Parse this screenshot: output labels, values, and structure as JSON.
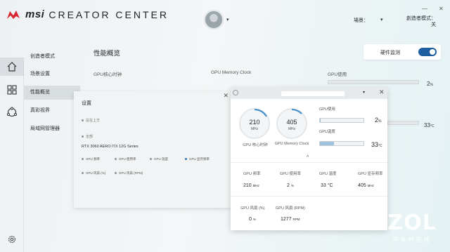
{
  "header": {
    "brand": "msi",
    "title": "CREATOR CENTER",
    "scene_label": "場景：",
    "creator_mode_line1": "創造者模式：",
    "creator_mode_line2": "关",
    "avatar_caret": "▾",
    "window_controls": [
      "—",
      "✕"
    ]
  },
  "sidebar": {
    "items": [
      {
        "label": "创造者模式",
        "active": false
      },
      {
        "label": "场景设置",
        "active": false
      },
      {
        "label": "性能概览",
        "active": true
      },
      {
        "label": "真彩视界",
        "active": false
      },
      {
        "label": "局域网管理器",
        "active": false
      }
    ]
  },
  "rail_icons": [
    "home-icon",
    "grid-icon",
    "network-icon",
    "settings-icon"
  ],
  "main": {
    "title": "性能概览",
    "hw_monitor_label": "硬件监测",
    "hw_monitor_on": true,
    "columns": [
      "GPU核心时钟",
      "GPU Memory Clock",
      "GPU使用"
    ],
    "bg_gpu_usage_value": "2",
    "bg_gpu_usage_unit": "%",
    "bg_gpu_temp_value": "33",
    "bg_gpu_temp_unit": "°C"
  },
  "settings": {
    "title": "设置",
    "close": "✕",
    "option_top": "总在上方",
    "section_label": "全部",
    "gpu_name": "RTX 3060 AERO ITX 12G Series",
    "options": [
      {
        "label": "GPU 频率",
        "on": false
      },
      {
        "label": "GPU 使用率",
        "on": false
      },
      {
        "label": "GPU 温度",
        "on": false
      },
      {
        "label": "GPU 显存频率",
        "on": true
      },
      {
        "label": "GPU 风扇 (%)",
        "on": false
      },
      {
        "label": "GPU 风扇 (RPM)",
        "on": false
      }
    ]
  },
  "overlay": {
    "close": "✕",
    "caret": "▾",
    "chevron": "^",
    "gauge1": {
      "value": "210",
      "unit": "MHz",
      "label": "GPU 核心时钟"
    },
    "gauge2": {
      "value": "405",
      "unit": "MHz",
      "label": "GPU Memory Clock"
    },
    "usage_label": "GPU使用",
    "usage_value": "2",
    "usage_unit": "%",
    "usage_fraction": 0.02,
    "temp_label": "GPU温度",
    "temp_value": "33",
    "temp_unit": "°C",
    "temp_fraction": 0.33,
    "cells_row1": [
      {
        "label": "GPU 频率",
        "value": "210",
        "unit": "MHz"
      },
      {
        "label": "GPU 使用率",
        "value": "2",
        "unit": "%"
      },
      {
        "label": "GPU 温度",
        "value": "33 °C",
        "unit": ""
      },
      {
        "label": "GPU 显存频率",
        "value": "405",
        "unit": "MHz"
      }
    ],
    "cells_row2": [
      {
        "label": "GPU 风扇 (%)",
        "value": "0",
        "unit": "%"
      },
      {
        "label": "GPU 风扇 (RPM)",
        "value": "1277",
        "unit": "RPM"
      }
    ]
  },
  "watermark": {
    "logo": "ZOL",
    "sub": "中关村在线"
  },
  "colors": {
    "accent": "#1d5fa0",
    "brand_red": "#d8282f",
    "bar_fill": "#9ec4dd"
  }
}
